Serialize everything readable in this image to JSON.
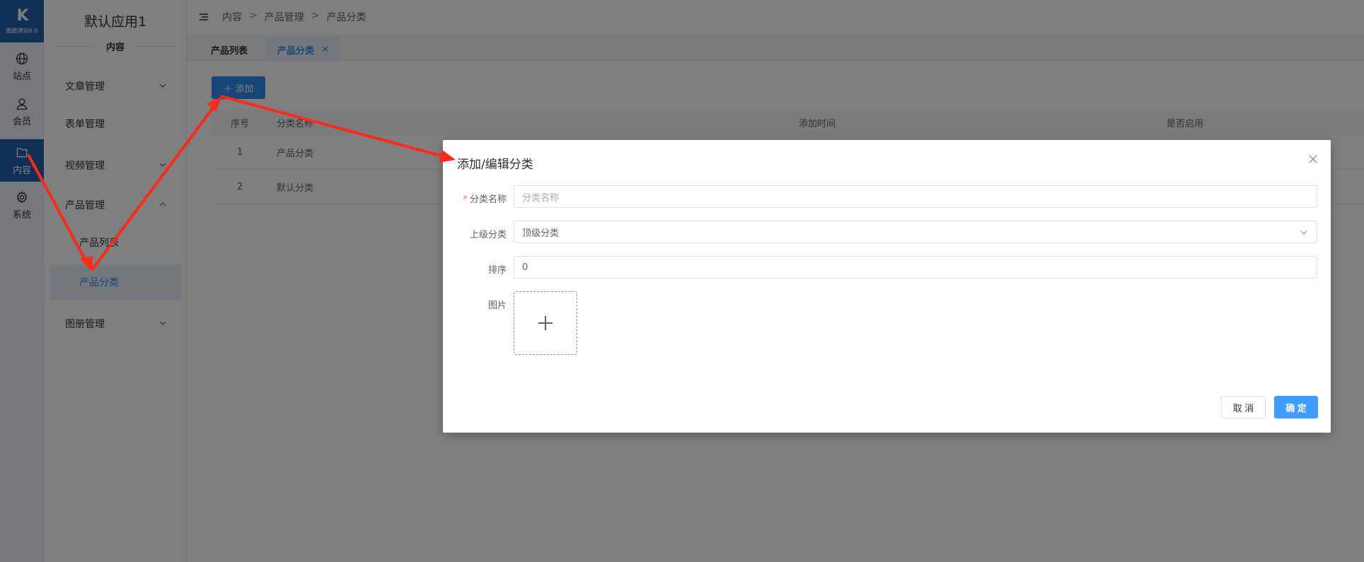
{
  "logo": {
    "mark": "K",
    "text": "酷酷建站6.0"
  },
  "rail": [
    {
      "label": "站点",
      "icon": "globe-icon"
    },
    {
      "label": "会员",
      "icon": "user-icon"
    },
    {
      "label": "内容",
      "icon": "folder-icon",
      "active": true
    },
    {
      "label": "系统",
      "icon": "gear-icon"
    }
  ],
  "menu": {
    "app_title": "默认应用1",
    "section": "内容",
    "items": [
      {
        "label": "文章管理"
      },
      {
        "label": "表单管理"
      },
      {
        "label": "视频管理"
      },
      {
        "label": "产品管理"
      },
      {
        "label": "产品列表"
      },
      {
        "label": "产品分类"
      },
      {
        "label": "图册管理"
      }
    ]
  },
  "breadcrumb": [
    "内容",
    "产品管理",
    "产品分类"
  ],
  "tabs": [
    {
      "label": "产品列表"
    },
    {
      "label": "产品分类",
      "active": true
    }
  ],
  "toolbar": {
    "add_label": "添加"
  },
  "table": {
    "headers": [
      "序号",
      "分类名称",
      "添加时间",
      "是否启用"
    ],
    "rows": [
      [
        "1",
        "产品分类"
      ],
      [
        "2",
        "默认分类"
      ]
    ]
  },
  "dialog": {
    "title": "添加/编辑分类",
    "name_label": "分类名称",
    "name_placeholder": "分类名称",
    "parent_label": "上级分类",
    "parent_value": "顶级分类",
    "sort_label": "排序",
    "sort_value": "0",
    "image_label": "图片",
    "cancel_label": "取 消",
    "ok_label": "确 定"
  },
  "colors": {
    "primary": "#2d8cf0",
    "brand": "#1e5fa8",
    "arrow": "#ff2a1a"
  }
}
